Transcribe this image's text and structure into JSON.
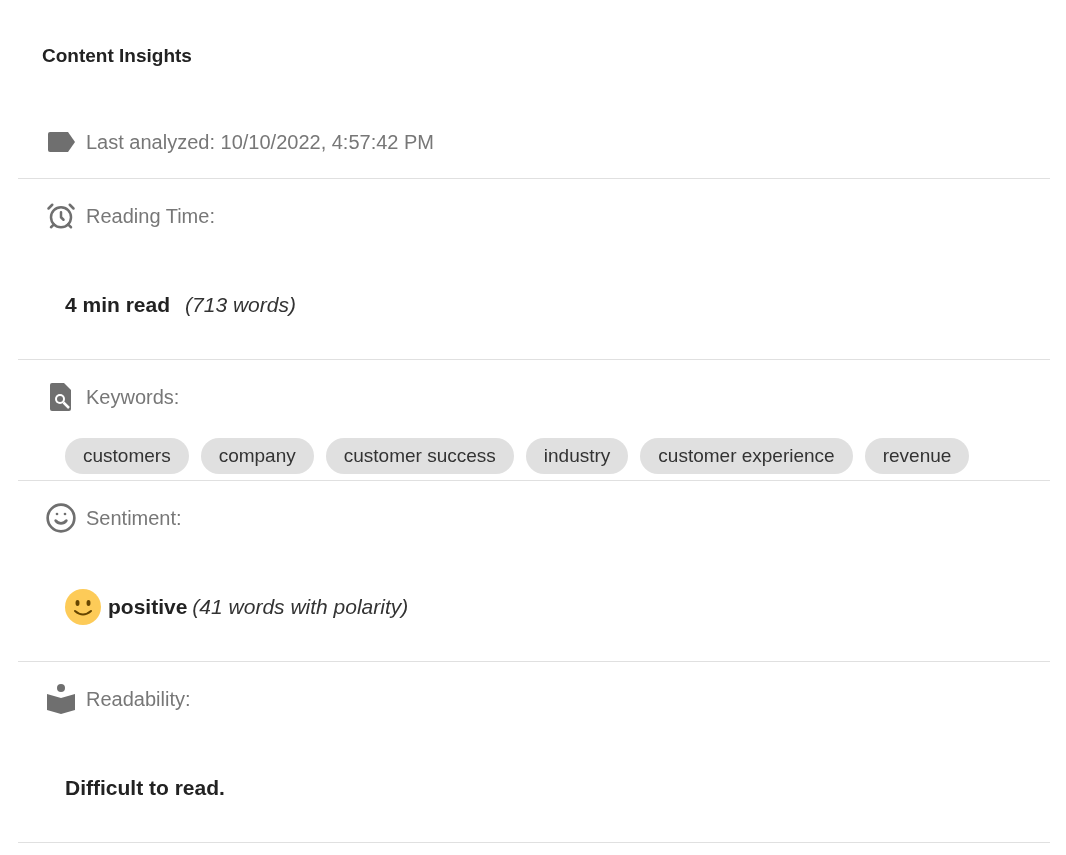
{
  "title": "Content Insights",
  "sections": [
    {
      "kind": "meta",
      "label": "Last analyzed: 10/10/2022, 4:57:42 PM"
    },
    {
      "kind": "value",
      "label": "Reading Time:",
      "value": "4 min read",
      "detail": "(713 words)"
    },
    {
      "kind": "chips",
      "label": "Keywords:",
      "keywords": [
        "customers",
        "company",
        "customer success",
        "industry",
        "customer experience",
        "revenue"
      ]
    },
    {
      "kind": "sentiment",
      "label": "Sentiment:",
      "value": "positive",
      "detail": "(41 words with polarity)"
    },
    {
      "kind": "value",
      "label": "Readability:",
      "value": "Difficult to read."
    }
  ]
}
